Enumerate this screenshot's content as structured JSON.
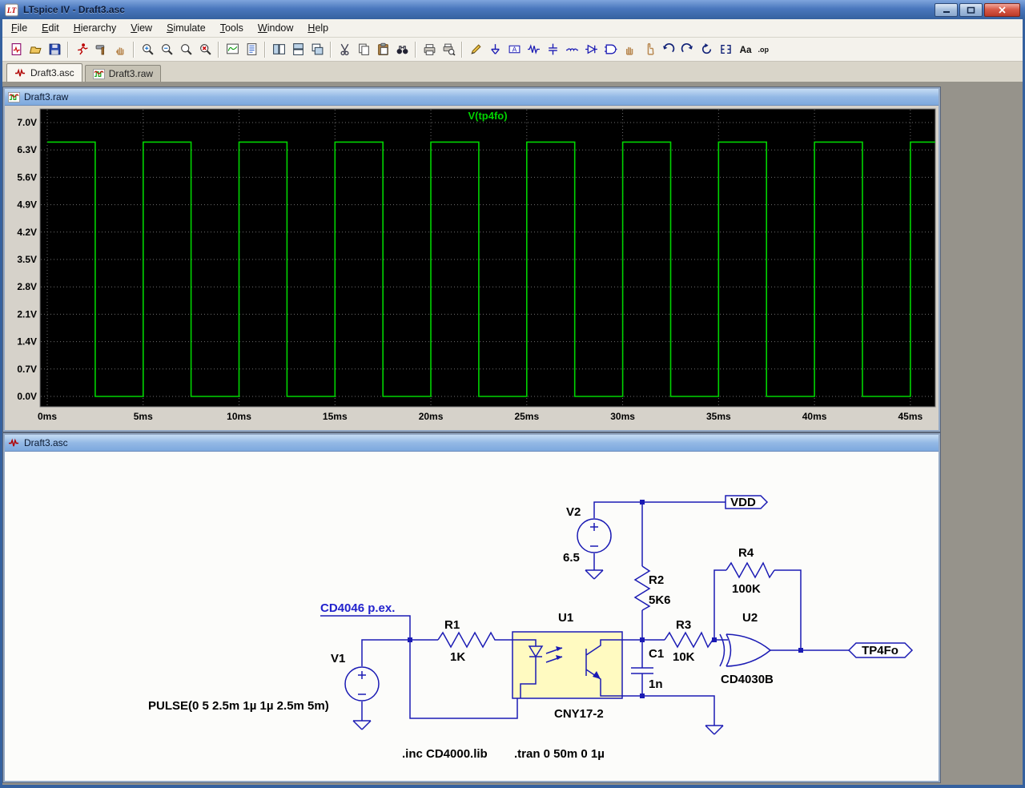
{
  "titlebar": {
    "title": "LTspice IV - Draft3.asc",
    "logo": "LT"
  },
  "menu": {
    "items": [
      "File",
      "Edit",
      "Hierarchy",
      "View",
      "Simulate",
      "Tools",
      "Window",
      "Help"
    ]
  },
  "toolbar": {
    "groups": [
      [
        "new-schematic",
        "open",
        "save"
      ],
      [
        "run",
        "control-panel",
        "pan"
      ],
      [
        "zoom-in",
        "zoom-out",
        "zoom-previous",
        "zoom-full-extents"
      ],
      [
        "autorange",
        "spice-netlist"
      ],
      [
        "tile-vertical",
        "tile-horizontal",
        "cascade"
      ],
      [
        "cut",
        "copy",
        "paste",
        "find"
      ],
      [
        "print",
        "print-preview"
      ],
      [
        "wire",
        "ground",
        "label-net",
        "resistor",
        "capacitor",
        "inductor",
        "diode",
        "component",
        "move",
        "drag",
        "undo",
        "redo",
        "rotate",
        "mirror",
        "text",
        "spice-directive"
      ]
    ]
  },
  "tabs": [
    {
      "label": "Draft3.asc",
      "icon": "schematic",
      "active": true
    },
    {
      "label": "Draft3.raw",
      "icon": "waveform",
      "active": false
    }
  ],
  "wave_window": {
    "title": "Draft3.raw"
  },
  "chart_data": {
    "type": "line",
    "title": "V(tp4fo)",
    "x_tick_ms": [
      0,
      5,
      10,
      15,
      20,
      25,
      30,
      35,
      40,
      45
    ],
    "x_tick_labels": [
      "0ms",
      "5ms",
      "10ms",
      "15ms",
      "20ms",
      "25ms",
      "30ms",
      "35ms",
      "40ms",
      "45ms"
    ],
    "y_tick_v": [
      7,
      6.3,
      5.6,
      4.9,
      4.2,
      3.5,
      2.8,
      2.1,
      1.4,
      0.7,
      0
    ],
    "y_tick_labels": [
      "7.0V",
      "6.3V",
      "5.6V",
      "4.9V",
      "4.2V",
      "3.5V",
      "2.8V",
      "2.1V",
      "1.4V",
      "0.7V",
      "0.0V"
    ],
    "x_max_ms": 46.3,
    "grid": true,
    "legend_position": "top-center",
    "background": "#000000",
    "grid_color": "#6e6e6e",
    "series": [
      {
        "name": "V(tp4fo)",
        "color": "#00d400",
        "waveform": "square",
        "high_v": 6.5,
        "low_v": 0,
        "period_ms": 5,
        "duty": 0.5,
        "points_ms_v": [
          [
            0,
            6.5
          ],
          [
            2.5,
            6.5
          ],
          [
            2.5,
            0
          ],
          [
            5,
            0
          ],
          [
            5,
            6.5
          ],
          [
            7.5,
            6.5
          ],
          [
            7.5,
            0
          ],
          [
            10,
            0
          ],
          [
            10,
            6.5
          ],
          [
            12.5,
            6.5
          ],
          [
            12.5,
            0
          ],
          [
            15,
            0
          ],
          [
            15,
            6.5
          ],
          [
            17.5,
            6.5
          ],
          [
            17.5,
            0
          ],
          [
            20,
            0
          ],
          [
            20,
            6.5
          ],
          [
            22.5,
            6.5
          ],
          [
            22.5,
            0
          ],
          [
            25,
            0
          ],
          [
            25,
            6.5
          ],
          [
            27.5,
            6.5
          ],
          [
            27.5,
            0
          ],
          [
            30,
            0
          ],
          [
            30,
            6.5
          ],
          [
            32.5,
            6.5
          ],
          [
            32.5,
            0
          ],
          [
            35,
            0
          ],
          [
            35,
            6.5
          ],
          [
            37.5,
            6.5
          ],
          [
            37.5,
            0
          ],
          [
            40,
            0
          ],
          [
            40,
            6.5
          ],
          [
            42.5,
            6.5
          ],
          [
            42.5,
            0
          ],
          [
            45,
            0
          ],
          [
            45,
            6.5
          ],
          [
            46.3,
            6.5
          ]
        ]
      }
    ]
  },
  "schematic": {
    "title": "Draft3.asc",
    "comment": "CD4046 p.ex.",
    "v1": {
      "name": "V1",
      "value": "PULSE(0 5 2.5m 1µ 1µ 2.5m 5m)"
    },
    "v2": {
      "name": "V2",
      "value": "6.5"
    },
    "r1": {
      "name": "R1",
      "value": "1K"
    },
    "r2": {
      "name": "R2",
      "value": "5K6"
    },
    "r3": {
      "name": "R3",
      "value": "10K"
    },
    "r4": {
      "name": "R4",
      "value": "100K"
    },
    "c1": {
      "name": "C1",
      "value": "1n"
    },
    "u1": {
      "name": "U1",
      "value": "CNY17-2"
    },
    "u2": {
      "name": "U2",
      "value": "CD4030B"
    },
    "flags": [
      "VDD",
      "TP4Fo"
    ],
    "directives": [
      ".inc CD4000.lib",
      ".tran 0 50m 0 1µ"
    ]
  },
  "colors": {
    "wire_blue": "#1b1bb4",
    "trace_green": "#00d400",
    "plot_background": "#000000",
    "u1_fill": "#fffac1"
  }
}
